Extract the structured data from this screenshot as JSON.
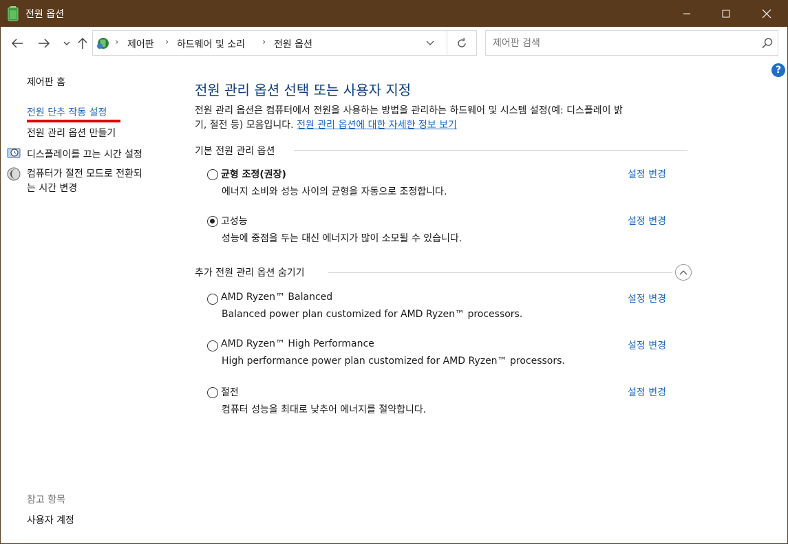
{
  "window": {
    "title": "전원 옵션",
    "controls": [
      "minimize",
      "maximize",
      "close"
    ]
  },
  "nav": {
    "back_icon": "arrow-left-icon",
    "forward_icon": "arrow-right-icon",
    "recent_icon": "chevron-down-icon",
    "up_icon": "arrow-up-icon",
    "breadcrumbs": [
      "제어판",
      "하드웨어 및 소리",
      "전원 옵션"
    ],
    "search_placeholder": "제어판 검색"
  },
  "sidebar": {
    "home": "제어판 홈",
    "links": [
      {
        "label": "전원 단추 작동 설정",
        "highlighted": true
      },
      {
        "label": "전원 관리 옵션 만들기"
      },
      {
        "label": "디스플레이를 끄는 시간 설정",
        "icon": "display-clock-icon"
      },
      {
        "label_line1": "컴퓨터가 절전 모드로 전환되",
        "label_line2": "는 시간 변경",
        "icon": "moon-sleep-icon"
      }
    ],
    "see_also_title": "참고 항목",
    "see_also_links": [
      "사용자 계정"
    ]
  },
  "main": {
    "title": "전원 관리 옵션 선택 또는 사용자 지정",
    "description_line1": "전원 관리 옵션은 컴퓨터에서 전원을 사용하는 방법을 관리하는 하드웨어 및 시스템 설정(예: 디스플레이 밝",
    "description_line2": "기, 절전 등) 모음입니다.",
    "description_link": "전원 관리 옵션에 대한 자세한 정보 보기",
    "basic_section": "기본 전원 관리 옵션",
    "extra_section": "추가 전원 관리 옵션 숨기기",
    "change_label": "설정 변경",
    "plans_basic": [
      {
        "name": "균형 조정(권장)",
        "desc": "에너지 소비와 성능 사이의 균형을 자동으로 조정합니다.",
        "selected": false,
        "bold": true
      },
      {
        "name": "고성능",
        "desc": "성능에 중점을 두는 대신 에너지가 많이 소모될 수 있습니다.",
        "selected": true,
        "bold": false
      }
    ],
    "plans_extra": [
      {
        "name": "AMD Ryzen™ Balanced",
        "desc": "Balanced power plan customized for AMD Ryzen™ processors.",
        "selected": false
      },
      {
        "name": "AMD Ryzen™ High Performance",
        "desc": "High performance power plan customized for AMD Ryzen™ processors.",
        "selected": false
      },
      {
        "name": "절전",
        "desc": "컴퓨터 성능을 최대로 낮추어 에너지를 절약합니다.",
        "selected": false
      }
    ]
  },
  "colors": {
    "titlebar": "#5a3a1c",
    "link": "#1a66c2",
    "heading": "#0d3d7e",
    "highlight_underline": "#e00000"
  }
}
